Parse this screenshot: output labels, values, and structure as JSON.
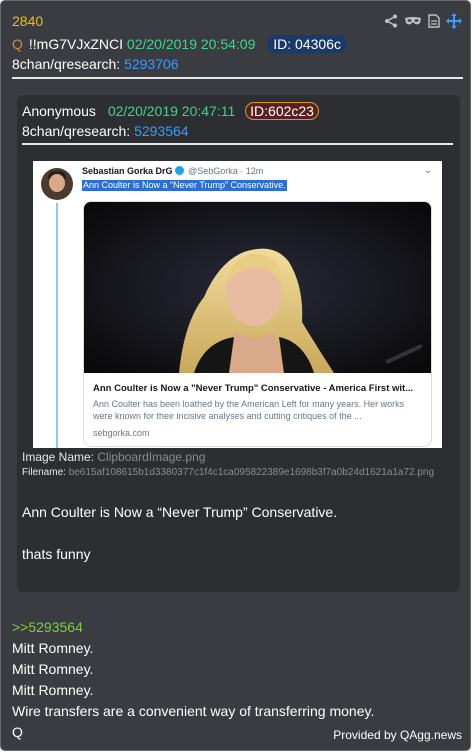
{
  "post": {
    "number": "2840",
    "q_marker": "Q",
    "tripcode": "!!mG7VJxZNCI",
    "datetime": "02/20/2019 20:54:09",
    "id_label": "ID: 04306c",
    "board": "8chan/qresearch:",
    "post_id": "5293706",
    "icons": [
      "share-icon",
      "mask-icon",
      "document-icon",
      "move-icon"
    ]
  },
  "quoted": {
    "author": "Anonymous",
    "datetime": "02/20/2019 20:47:11",
    "id_label": "ID:602c23",
    "board": "8chan/qresearch:",
    "post_id": "5293564",
    "tweet": {
      "name": "Sebastian Gorka DrG",
      "handle": "@SebGorka · 12m",
      "text": "Ann Coulter is Now a “Never Trump” Conservative.",
      "card_title": "Ann Coulter is Now a \"Never Trump\" Conservative - America First wit...",
      "card_desc": "Ann Coulter has been loathed by the American Left for many years. Her works were known for their incisive analyses and cutting critiques of the ...",
      "card_domain": "sebgorka.com"
    },
    "image_name_label": "Image Name:",
    "image_name": "ClipboardImage.png",
    "filename_label": "Filename:",
    "filename": "be615af108615b1d3380377c1f4c1ca095822389e1698b3f7a0b24d1621a1a72.png",
    "text_line1": "Ann Coulter is Now a “Never Trump” Conservative.",
    "text_line2": "thats funny"
  },
  "body": {
    "reply_ref": ">>5293564",
    "lines": [
      "Mitt Romney.",
      "Mitt Romney.",
      "Mitt Romney.",
      "Wire transfers are a convenient way of transferring money.",
      "Q"
    ]
  },
  "footer": "Provided by QAgg.news",
  "colors": {
    "background": "#3a3c41",
    "accent_number": "#f0c000",
    "date": "#3dd68c",
    "link": "#3b9cff",
    "reply": "#7fd03a"
  }
}
